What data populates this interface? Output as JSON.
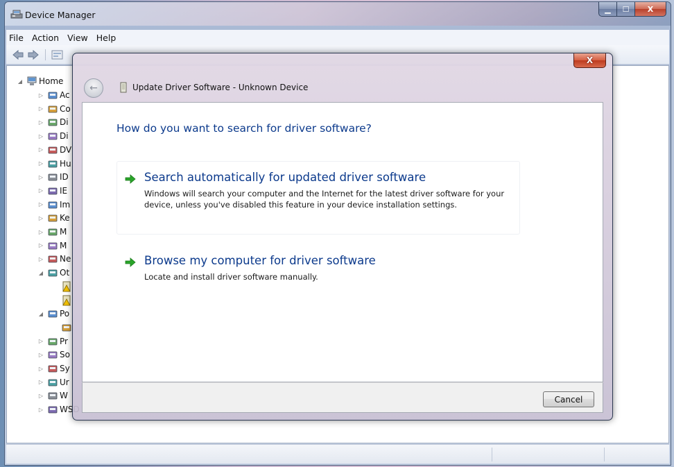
{
  "main_window": {
    "title": "Device Manager",
    "controls": {
      "minimize": "▁",
      "maximize": "☐",
      "close": "X"
    }
  },
  "menu": [
    "File",
    "Action",
    "View",
    "Help"
  ],
  "tree": {
    "root_label": "Home",
    "nodes": [
      {
        "label": "Ac",
        "icon": "audio-inputs-icon",
        "expander": "▷"
      },
      {
        "label": "Co",
        "icon": "computer-icon",
        "expander": "▷"
      },
      {
        "label": "Di",
        "icon": "disk-drives-icon",
        "expander": "▷"
      },
      {
        "label": "Di",
        "icon": "display-adapters-icon",
        "expander": "▷"
      },
      {
        "label": "DV",
        "icon": "dvd-drive-icon",
        "expander": "▷"
      },
      {
        "label": "Hu",
        "icon": "hid-icon",
        "expander": "▷"
      },
      {
        "label": "ID",
        "icon": "ide-controller-icon",
        "expander": "▷"
      },
      {
        "label": "IE",
        "icon": "ieee1394-icon",
        "expander": "▷"
      },
      {
        "label": "Im",
        "icon": "imaging-devices-icon",
        "expander": "▷"
      },
      {
        "label": "Ke",
        "icon": "keyboard-icon",
        "expander": "▷"
      },
      {
        "label": "M",
        "icon": "mouse-icon",
        "expander": "▷"
      },
      {
        "label": "M",
        "icon": "monitor-icon",
        "expander": "▷"
      },
      {
        "label": "Ne",
        "icon": "network-adapter-icon",
        "expander": "▷"
      },
      {
        "label": "Ot",
        "icon": "other-devices-icon",
        "expander": "◢"
      },
      {
        "label": "",
        "icon": "unknown-device-icon",
        "expander": ""
      },
      {
        "label": "",
        "icon": "unknown-device-icon",
        "expander": ""
      },
      {
        "label": "Po",
        "icon": "ports-icon",
        "expander": "◢"
      },
      {
        "label": "",
        "icon": "port-icon",
        "expander": ""
      },
      {
        "label": "Pr",
        "icon": "processor-icon",
        "expander": "▷"
      },
      {
        "label": "So",
        "icon": "sound-icon",
        "expander": "▷"
      },
      {
        "label": "Sy",
        "icon": "system-devices-icon",
        "expander": "▷"
      },
      {
        "label": "Ur",
        "icon": "usb-controller-icon",
        "expander": "▷"
      },
      {
        "label": "W",
        "icon": "wsd-icon",
        "expander": "▷"
      },
      {
        "label": "WSD Print Provider",
        "icon": "printer-icon",
        "expander": "▷"
      }
    ]
  },
  "dialog": {
    "title": "Update Driver Software - Unknown Device",
    "close_label": "X",
    "question": "How do you want to search for driver software?",
    "options": [
      {
        "title": "Search automatically for updated driver software",
        "description": "Windows will search your computer and the Internet for the latest driver software for your device, unless you've disabled this feature in your device installation settings."
      },
      {
        "title": "Browse my computer for driver software",
        "description": "Locate and install driver software manually."
      }
    ],
    "cancel_label": "Cancel",
    "back_glyph": "←"
  },
  "colors": {
    "heading_blue": "#0c3a8c",
    "arrow_green": "#2aa52a",
    "close_red": "#c8442a"
  }
}
